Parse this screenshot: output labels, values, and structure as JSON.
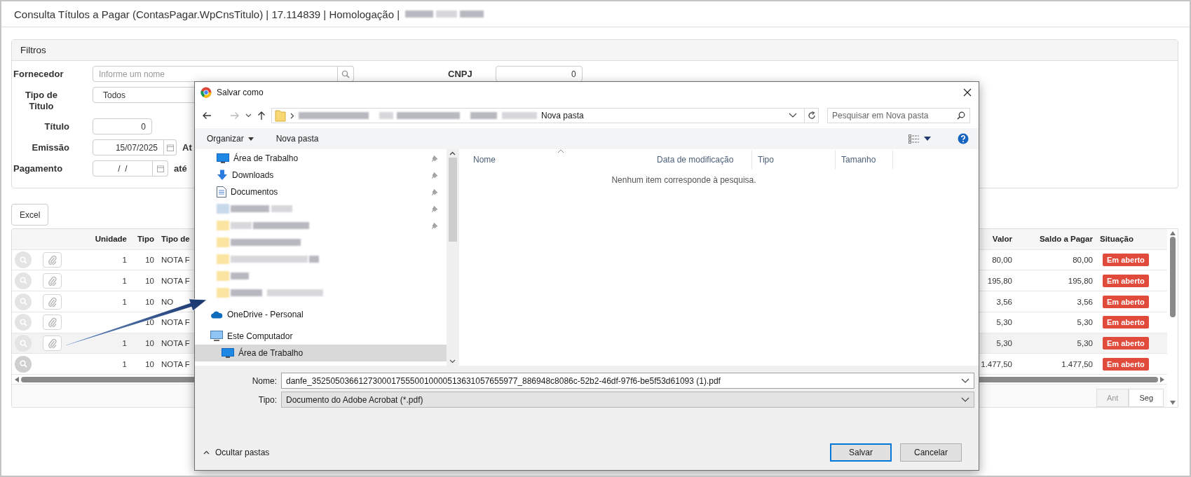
{
  "page": {
    "title": "Consulta Títulos a Pagar (ContasPagar.WpCnsTitulo) | 17.114839 | Homologação |"
  },
  "filters": {
    "title": "Filtros",
    "fornecedor": {
      "label": "Fornecedor",
      "placeholder": "Informe um nome"
    },
    "cnpj": {
      "label": "CNPJ",
      "value": "0"
    },
    "tipo": {
      "label": "Tipo de Titulo",
      "value": "Todos"
    },
    "titulo": {
      "label": "Título",
      "value": "0"
    },
    "emissao": {
      "label": "Emissão",
      "value": "15/07/2025",
      "to_label": "At"
    },
    "pagamento": {
      "label": "Pagamento",
      "value": "/  /",
      "to_label": "até"
    }
  },
  "excel_button": "Excel",
  "table": {
    "columns": [
      "Unidade",
      "Tipo",
      "Tipo de",
      "Valor",
      "Saldo a Pagar",
      "Situação"
    ],
    "rows": [
      {
        "unidade": "1",
        "tipo": "10",
        "tipo_de": "NOTA F",
        "valor": "80,00",
        "saldo": "80,00",
        "situacao": "Em aberto",
        "attachment": true,
        "highlighted": false
      },
      {
        "unidade": "1",
        "tipo": "10",
        "tipo_de": "NOTA F",
        "valor": "195,80",
        "saldo": "195,80",
        "situacao": "Em aberto",
        "attachment": true,
        "highlighted": false
      },
      {
        "unidade": "1",
        "tipo": "10",
        "tipo_de": "NO",
        "valor": "3,56",
        "saldo": "3,56",
        "situacao": "Em aberto",
        "attachment": true,
        "highlighted": false
      },
      {
        "tipo": "10",
        "tipo_de": "NOTA F",
        "valor": "5,30",
        "saldo": "5,30",
        "situacao": "Em aberto",
        "attachment": true,
        "highlighted": false
      },
      {
        "unidade": "1",
        "tipo": "10",
        "tipo_de": "NOTA F",
        "valor": "5,30",
        "saldo": "5,30",
        "situacao": "Em aberto",
        "attachment": true,
        "highlighted": true
      },
      {
        "unidade": "1",
        "tipo": "10",
        "tipo_de": "NOTA F",
        "valor": "1.477,50",
        "saldo": "1.477,50",
        "situacao": "Em aberto",
        "attachment": false,
        "highlighted": false
      }
    ],
    "pager": [
      {
        "label": "Ant",
        "disabled": true
      },
      {
        "label": "Seg",
        "disabled": false
      }
    ]
  },
  "dialog": {
    "title": "Salvar como",
    "address": "Nova pasta",
    "search_placeholder": "Pesquisar em Nova pasta",
    "toolbar": [
      "Organizar",
      "Nova pasta"
    ],
    "nav": [
      {
        "label": "Área de Trabalho",
        "kind": "desktop",
        "pinned": true,
        "selected": false
      },
      {
        "label": "Downloads",
        "kind": "download",
        "pinned": true,
        "selected": false
      },
      {
        "label": "Documentos",
        "kind": "document",
        "pinned": true,
        "selected": false
      },
      {
        "kind": "blurred",
        "pinned": true,
        "selected": false
      },
      {
        "kind": "blurred",
        "pinned": true,
        "selected": false
      },
      {
        "kind": "blurred",
        "pinned": false,
        "selected": false
      },
      {
        "kind": "blurred",
        "pinned": false,
        "selected": false
      },
      {
        "kind": "blurred",
        "pinned": false,
        "selected": false
      },
      {
        "kind": "blurred",
        "pinned": false,
        "selected": false
      },
      {
        "label": "OneDrive - Personal",
        "kind": "cloud",
        "pinned": false,
        "selected": false
      },
      {
        "label": "Este Computador",
        "kind": "computer",
        "pinned": false,
        "selected": false,
        "children": [
          {
            "label": "Área de Trabalho",
            "kind": "desktop",
            "pinned": false,
            "selected": true
          }
        ]
      }
    ],
    "columns": [
      "Nome",
      "Data de modificação",
      "Tipo",
      "Tamanho"
    ],
    "empty_message": "Nenhum item corresponde à pesquisa.",
    "filename_label": "Nome:",
    "filename": "danfe_35250503661273000175550010000513631057655977_886948c8086c-52b2-46df-97f6-be5f53d61093 (1).pdf",
    "type_label": "Tipo:",
    "type_value": "Documento do Adobe Acrobat (*.pdf)",
    "hide_folders": "Ocultar pastas",
    "buttons": [
      "Salvar",
      "Cancelar"
    ]
  }
}
